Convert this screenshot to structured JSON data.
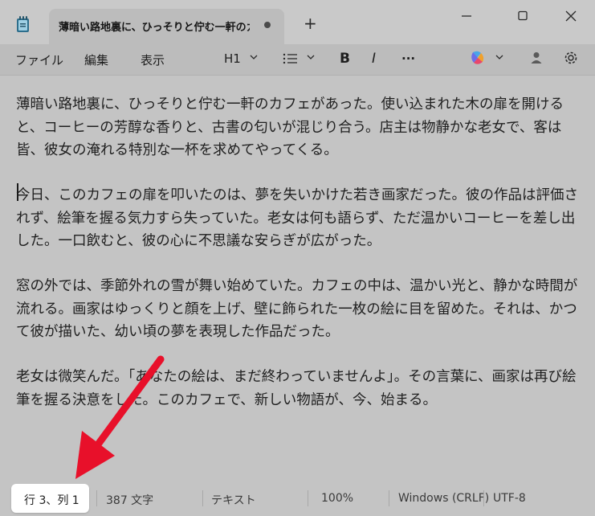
{
  "tab": {
    "title": "薄暗い路地裏に、ひっそりと佇む一軒のカ",
    "new_tab_label": "+"
  },
  "menu": {
    "file": "ファイル",
    "edit": "編集",
    "view": "表示"
  },
  "toolbar": {
    "heading": "H1",
    "bold": "B",
    "italic": "I",
    "more": "···"
  },
  "document": {
    "paragraphs": [
      "薄暗い路地裏に、ひっそりと佇む一軒のカフェがあった。使い込まれた木の扉を開けると、コーヒーの芳醇な香りと、古書の匂いが混じり合う。店主は物静かな老女で、客は皆、彼女の淹れる特別な一杯を求めてやってくる。",
      "今日、このカフェの扉を叩いたのは、夢を失いかけた若き画家だった。彼の作品は評価されず、絵筆を握る気力すら失っていた。老女は何も語らず、ただ温かいコーヒーを差し出した。一口飲むと、彼の心に不思議な安らぎが広がった。",
      "窓の外では、季節外れの雪が舞い始めていた。カフェの中は、温かい光と、静かな時間が流れる。画家はゆっくりと顔を上げ、壁に飾られた一枚の絵に目を留めた。それは、かつて彼が描いた、幼い頃の夢を表現した作品だった。",
      "老女は微笑んだ。「あなたの絵は、まだ終わっていませんよ」。その言葉に、画家は再び絵筆を握る決意をした。このカフェで、新しい物語が、今、始まる。"
    ]
  },
  "status": {
    "position": "行 3、列 1",
    "char_count": "387 文字",
    "format": "テキスト",
    "zoom": "100%",
    "line_ending": "Windows (CRLF)",
    "encoding": "UTF-8"
  },
  "colors": {
    "arrow": "#e8102a",
    "highlight": "#ffffff",
    "dim_background": "#c4c4c4"
  }
}
